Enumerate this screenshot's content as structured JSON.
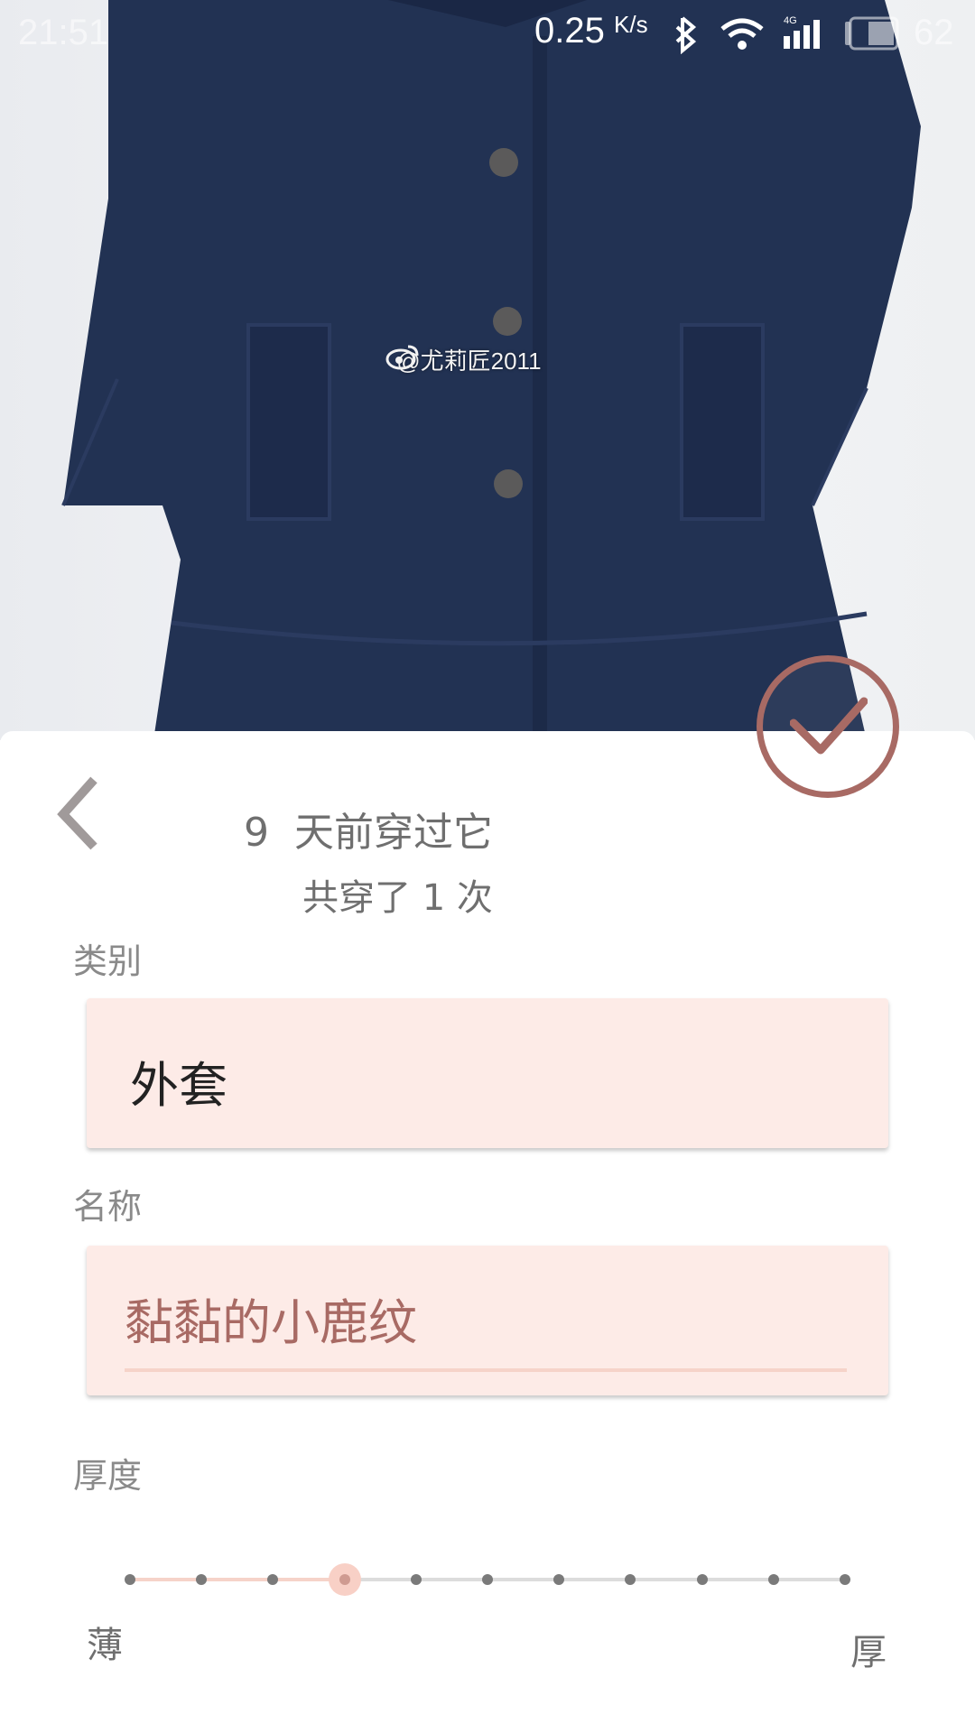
{
  "status_bar": {
    "time": "21:51",
    "net_speed": "0.25",
    "net_speed_unit": "K/s",
    "network_type": "4G",
    "battery_level": "62",
    "icons": [
      "bluetooth-icon",
      "wifi-icon",
      "signal-icon",
      "battery-icon"
    ]
  },
  "photo": {
    "watermark": "@尤莉匠2011"
  },
  "header": {
    "days_number": "9",
    "days_text": "天前穿过它",
    "worn_count_text": "共穿了 1 次"
  },
  "category": {
    "label": "类别",
    "value": "外套"
  },
  "name": {
    "label": "名称",
    "value": "黏黏的小鹿纹"
  },
  "thickness": {
    "label": "厚度",
    "min_label": "薄",
    "max_label": "厚",
    "steps": 11,
    "selected_index": 3
  },
  "colors": {
    "accent": "#a86a64",
    "field_background": "#fdebe7",
    "slider_active": "#f6d3c9"
  }
}
